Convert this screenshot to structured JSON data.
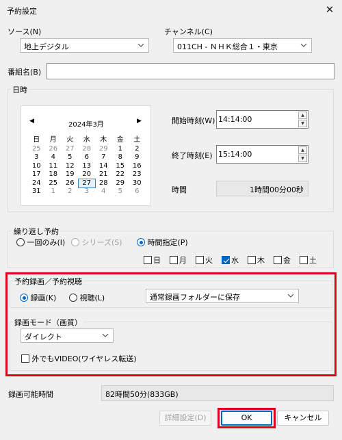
{
  "window": {
    "title": "予約設定",
    "close_label": "✕"
  },
  "source": {
    "label": "ソース(N)",
    "value": "地上デジタル"
  },
  "channel": {
    "label": "チャンネル(C)",
    "value": "011CH - ＮＨＫ総合１・東京"
  },
  "program": {
    "label": "番組名(B)",
    "value": ""
  },
  "datetime": {
    "group_label": "日時",
    "calendar": {
      "prev": "◀",
      "next": "▶",
      "month": "2024年3月",
      "weekdays": [
        "日",
        "月",
        "火",
        "水",
        "木",
        "金",
        "土"
      ],
      "weeks": [
        [
          "25",
          "26",
          "27",
          "28",
          "29",
          "1",
          "2"
        ],
        [
          "3",
          "4",
          "5",
          "6",
          "7",
          "8",
          "9"
        ],
        [
          "10",
          "11",
          "12",
          "13",
          "14",
          "15",
          "16"
        ],
        [
          "17",
          "18",
          "19",
          "20",
          "21",
          "22",
          "23"
        ],
        [
          "24",
          "25",
          "26",
          "27",
          "28",
          "29",
          "30"
        ],
        [
          "31",
          "1",
          "2",
          "3",
          "4",
          "5",
          "6"
        ]
      ],
      "selected": "27"
    },
    "start": {
      "label": "開始時刻(W)",
      "value": "14:14:00"
    },
    "end": {
      "label": "終了時刻(E)",
      "value": "15:14:00"
    },
    "duration": {
      "label": "時間",
      "value": "1時間00分00秒"
    }
  },
  "repeat": {
    "group_label": "繰り返し予約",
    "once": "一回のみ(I)",
    "series": "シリーズ(S)",
    "time": "時間指定(P)",
    "selected": "時間指定(P)",
    "days": [
      "日",
      "月",
      "火",
      "水",
      "木",
      "金",
      "土"
    ],
    "checked_days": [
      "水"
    ]
  },
  "record": {
    "group_label": "予約録画／予約視聴",
    "record_option": "録画(K)",
    "view_option": "視聴(L)",
    "selected": "録画(K)",
    "folder": "通常録画フォルダーに保存",
    "mode_label": "録画モード（画質）",
    "mode_value": "ダイレクト",
    "outside_label": "外でもVIDEO(ワイヤレス転送)",
    "outside_checked": false
  },
  "available": {
    "label": "録画可能時間",
    "value": "82時間50分(833GB)"
  },
  "buttons": {
    "details": "詳細設定(D)",
    "ok": "OK",
    "cancel": "キャンセル"
  }
}
